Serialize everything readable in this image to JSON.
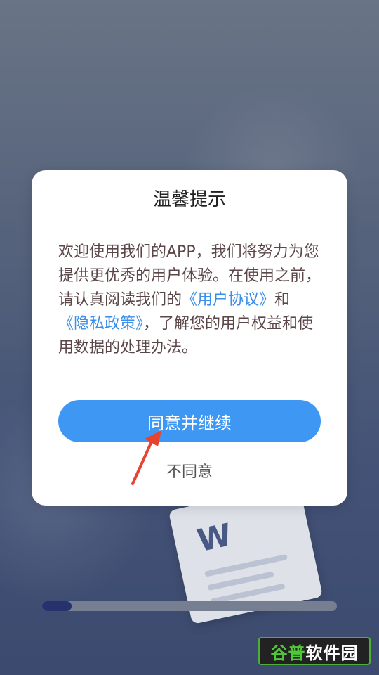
{
  "dialog": {
    "title": "温馨提示",
    "body": {
      "text_1": "欢迎使用我们的APP，我们将努力为您提供更优秀的用户体验。在使用之前，请认真阅读我们的",
      "link_user_agreement": "《用户协议》",
      "text_2": "和",
      "link_privacy_policy": "《隐私政策》",
      "text_3": "，了解您的用户权益和使用数据的处理办法。"
    },
    "agree_label": "同意并继续",
    "disagree_label": "不同意"
  },
  "background": {
    "doc_icon_letter": "W"
  },
  "progress": {
    "value": 0.1
  },
  "watermark": {
    "part_1": "谷普",
    "part_2": "软件园"
  },
  "colors": {
    "primary": "#3f97f4",
    "link": "#3b8eea",
    "body_text": "#5b4648",
    "arrow": "#e8432e",
    "progress_fill": "#28316f",
    "progress_track": "#7d8597"
  }
}
